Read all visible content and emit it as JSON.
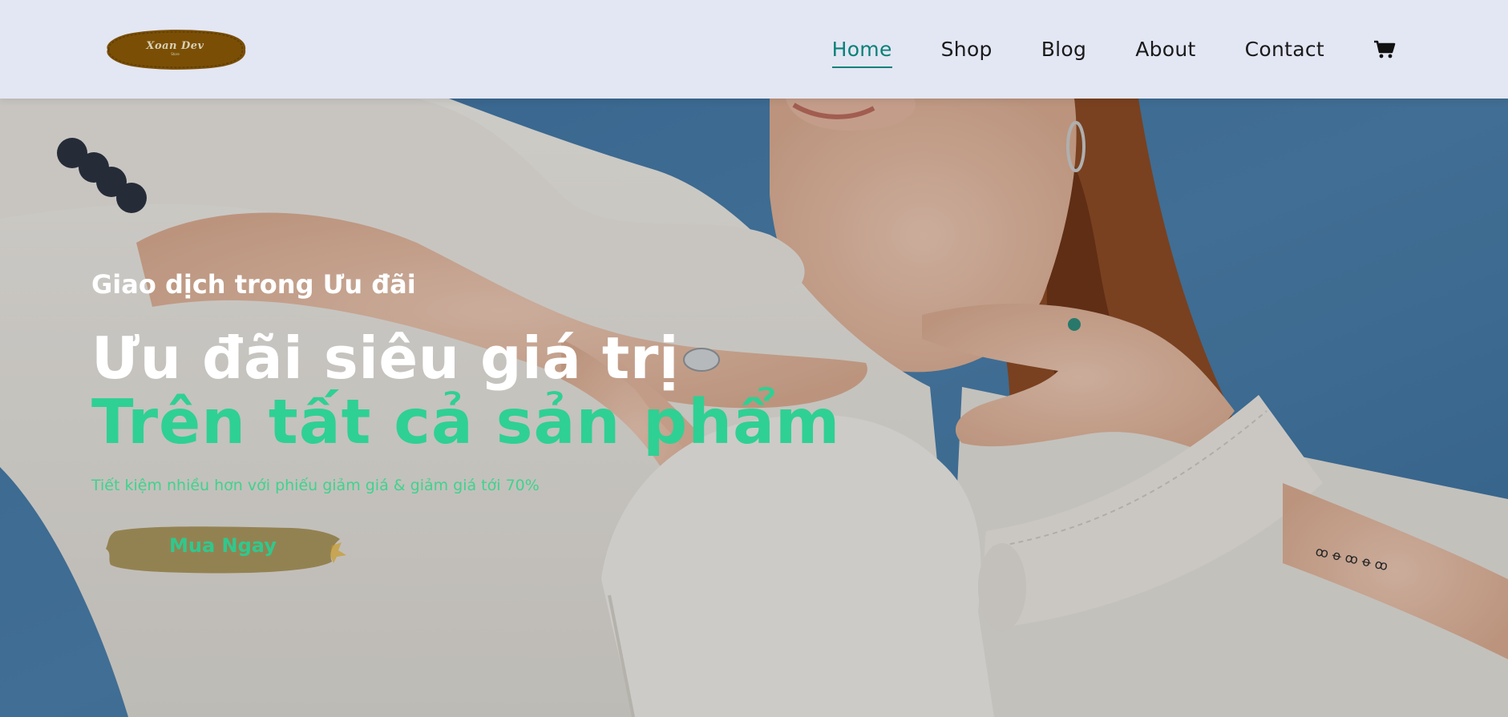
{
  "header": {
    "logo": {
      "name": "Xoan Dev",
      "tagline": "Store"
    },
    "nav": [
      {
        "label": "Home",
        "active": true
      },
      {
        "label": "Shop",
        "active": false
      },
      {
        "label": "Blog",
        "active": false
      },
      {
        "label": "About",
        "active": false
      },
      {
        "label": "Contact",
        "active": false
      }
    ],
    "cart_icon": "shopping-cart-icon"
  },
  "hero": {
    "kicker": "Giao dịch trong Ưu đãi",
    "headline": "Ưu đãi siêu giá trị",
    "headline_accent": "Trên tất cả sản phẩm",
    "subtext": "Tiết kiệm nhiều hơn với phiếu giảm giá & giảm giá tới 70%",
    "cta_label": "Mua Ngay"
  },
  "colors": {
    "header_bg": "#e3e6f3",
    "nav_active": "#088178",
    "accent_green": "#2fd093",
    "logo_brown": "#7a4f05",
    "button_brush": "#8c7a42"
  }
}
